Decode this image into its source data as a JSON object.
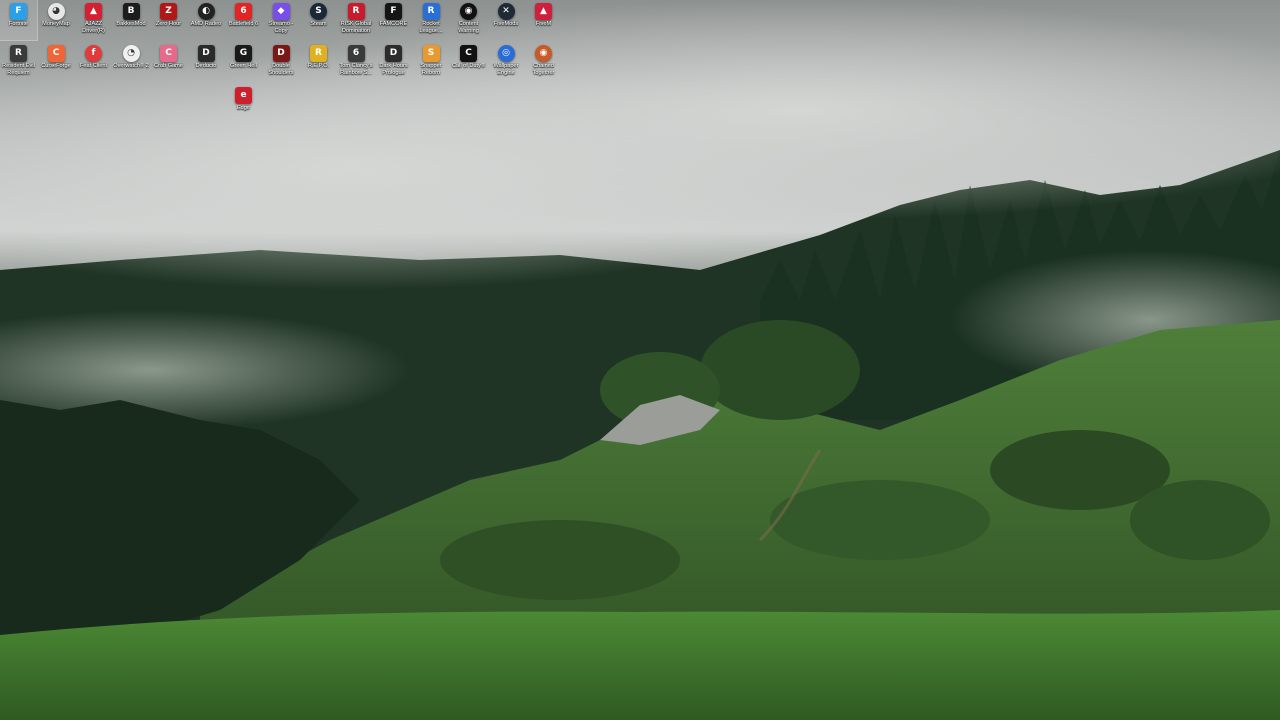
{
  "desktop": {
    "wallpaper": "foggy-forest-hillside",
    "colors": {
      "fog": "#c9ccca",
      "forest": "#1f3a24",
      "grass": "#3f7a2c"
    },
    "icons": [
      {
        "label": "Fortnite",
        "icon": "fortnite-icon",
        "bg": "#2aa0e8",
        "glyph": "F",
        "round": false
      },
      {
        "label": "MoneyMap",
        "icon": "moneymap-icon",
        "bg": "#e6e6e6",
        "glyph": "◕",
        "round": true
      },
      {
        "label": "AJAZZ Driver(R)",
        "icon": "ajazz-icon",
        "bg": "#d42030",
        "glyph": "▲",
        "round": false
      },
      {
        "label": "BakkesMod",
        "icon": "bakkesmod-icon",
        "bg": "#1c1c1c",
        "glyph": "B",
        "round": false
      },
      {
        "label": "Zero Hour",
        "icon": "zero-hour-icon",
        "bg": "#b01818",
        "glyph": "Z",
        "round": false
      },
      {
        "label": "AMD Radeo",
        "icon": "amd-radeon-icon",
        "bg": "#222222",
        "glyph": "◐",
        "round": true
      },
      {
        "label": "Battlefield 6",
        "icon": "battlefield-icon",
        "bg": "#e22424",
        "glyph": "6",
        "round": false
      },
      {
        "label": "Streamo - Copy",
        "icon": "streamo-icon",
        "bg": "#7a4ee8",
        "glyph": "◆",
        "round": false
      },
      {
        "label": "Steam",
        "icon": "steam-icon",
        "bg": "#1b2838",
        "glyph": "S",
        "round": true
      },
      {
        "label": "RISK Global Domination",
        "icon": "risk-icon",
        "bg": "#c81c2c",
        "glyph": "R",
        "round": false
      },
      {
        "label": "FAMCORE",
        "icon": "famcore-icon",
        "bg": "#151515",
        "glyph": "F",
        "round": false
      },
      {
        "label": "Rocket League...",
        "icon": "rocket-league-icon",
        "bg": "#2a6fd6",
        "glyph": "R",
        "round": false
      },
      {
        "label": "Content Warning",
        "icon": "content-warning-icon",
        "bg": "#111111",
        "glyph": "◉",
        "round": true
      },
      {
        "label": "FiveMods",
        "icon": "fivemods-icon",
        "bg": "#1e2a36",
        "glyph": "✕",
        "round": true
      },
      {
        "label": "FiveM",
        "icon": "fivem-icon",
        "bg": "#d01f3c",
        "glyph": "▲",
        "round": false
      },
      {
        "label": "Resident Evil Requiem",
        "icon": "resident-evil-icon",
        "bg": "#3a3a3a",
        "glyph": "R",
        "round": false
      },
      {
        "label": "CurseForge",
        "icon": "curseforge-icon",
        "bg": "#f16436",
        "glyph": "C",
        "round": false
      },
      {
        "label": "Feat Client",
        "icon": "feat-client-icon",
        "bg": "#e23a3a",
        "glyph": "f",
        "round": true
      },
      {
        "label": "Overwatch® 2",
        "icon": "overwatch-icon",
        "bg": "#f0f0f0",
        "glyph": "◔",
        "round": true
      },
      {
        "label": "Crab Game",
        "icon": "crab-game-icon",
        "bg": "#e86a8a",
        "glyph": "C",
        "round": false
      },
      {
        "label": "Deducto",
        "icon": "deducto-icon",
        "bg": "#2a2a2a",
        "glyph": "D",
        "round": false
      },
      {
        "label": "Green Hell",
        "icon": "green-hell-icon",
        "bg": "#1a1a1a",
        "glyph": "G",
        "round": false
      },
      {
        "label": "Double Shoulders",
        "icon": "double-shoulders-icon",
        "bg": "#7a1818",
        "glyph": "D",
        "round": false
      },
      {
        "label": "R.E.P.O.",
        "icon": "repo-icon",
        "bg": "#e0b020",
        "glyph": "R",
        "round": false
      },
      {
        "label": "Tom Clancy's Rainbow S...",
        "icon": "rainbow-six-icon",
        "bg": "#3a3a3a",
        "glyph": "6",
        "round": false
      },
      {
        "label": "Dark Hours Prologue",
        "icon": "dark-hours-icon",
        "bg": "#2c2c2c",
        "glyph": "D",
        "round": false
      },
      {
        "label": "Snapper Reborn",
        "icon": "snapper-icon",
        "bg": "#e89a30",
        "glyph": "S",
        "round": false
      },
      {
        "label": "Call of Duty®",
        "icon": "call-of-duty-icon",
        "bg": "#111111",
        "glyph": "C",
        "round": false
      },
      {
        "label": "Wallpaper Engine",
        "icon": "wallpaper-engine-icon",
        "bg": "#2a6cd6",
        "glyph": "◎",
        "round": true
      },
      {
        "label": "Chained Together",
        "icon": "chained-together-icon",
        "bg": "#c85a28",
        "glyph": "◉",
        "round": true
      },
      {
        "label": "Edge",
        "icon": "edge-icon",
        "bg": "#d01f2c",
        "glyph": "e",
        "round": false
      }
    ]
  }
}
